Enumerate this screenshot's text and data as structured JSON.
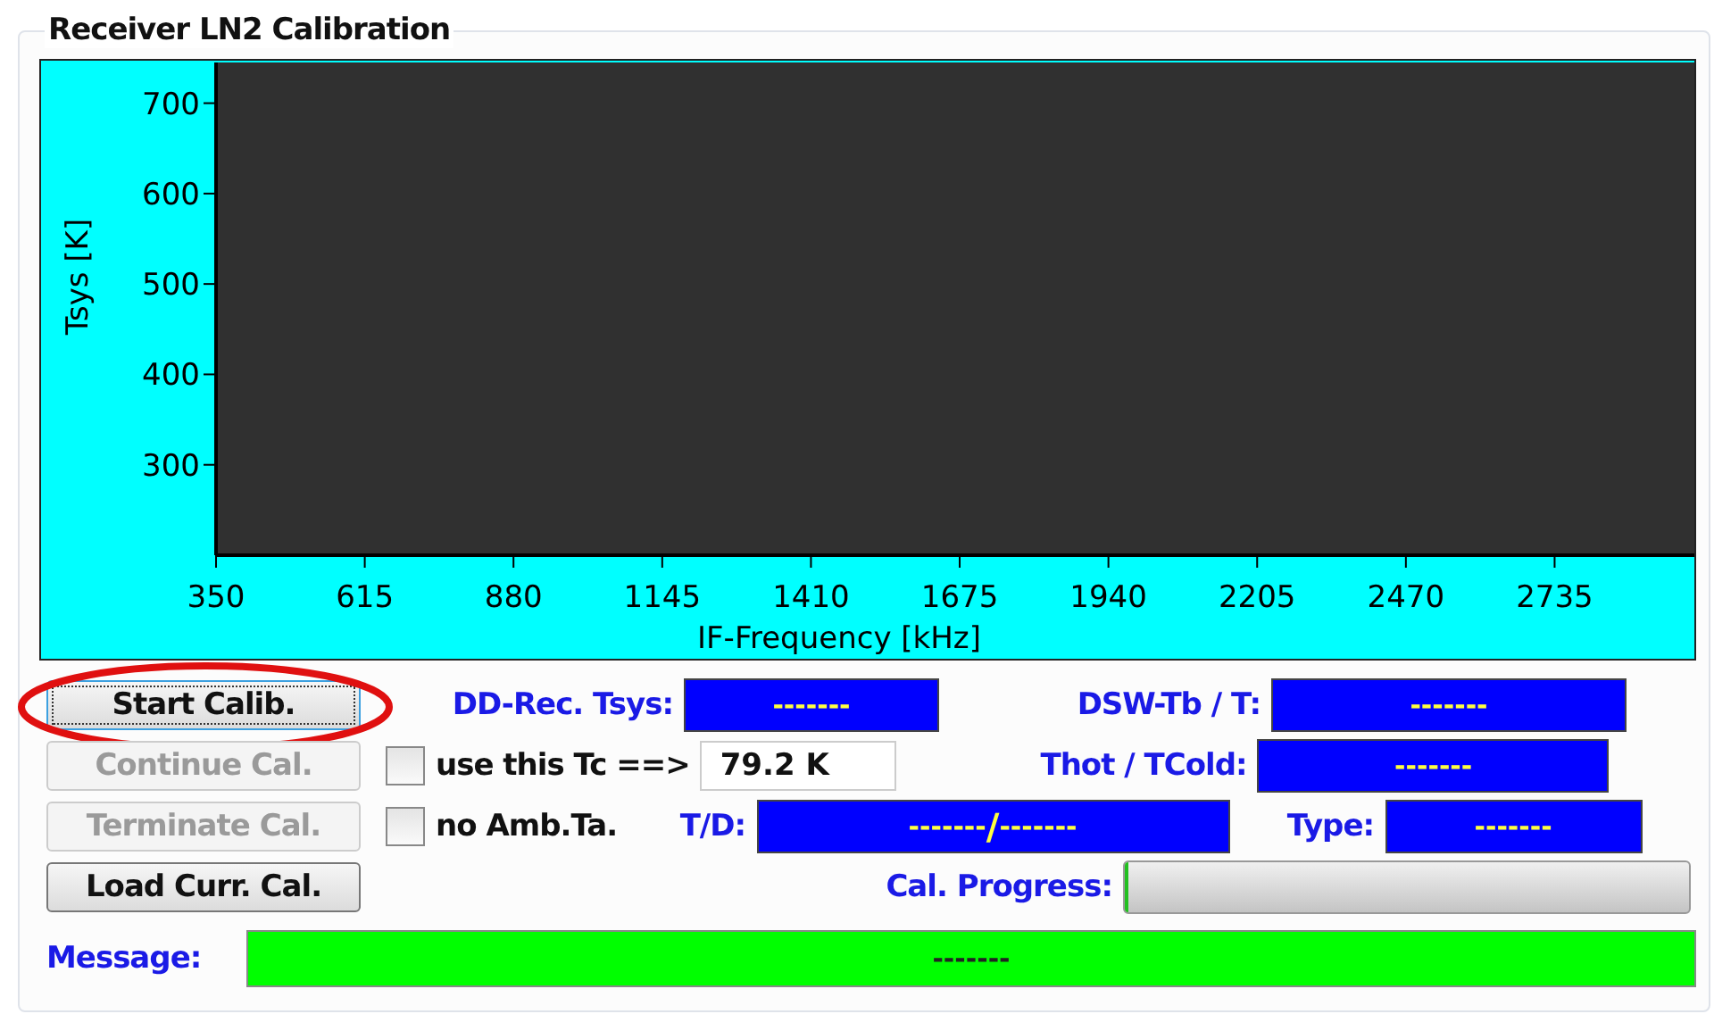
{
  "group_title": "Receiver LN2 Calibration",
  "chart": {
    "chart_data": {
      "type": "line",
      "xlabel": "IF-Frequency [kHz]",
      "ylabel": "Tsys [K]",
      "xlim": [
        350,
        2984
      ],
      "ylim": [
        200,
        745
      ],
      "xticks": [
        350,
        615,
        880,
        1145,
        1410,
        1675,
        1940,
        2205,
        2470,
        2735
      ],
      "yticks": [
        300,
        400,
        500,
        600,
        700
      ]
    }
  },
  "buttons": [
    {
      "label": "Start Calib.",
      "disabled": false,
      "focused": true,
      "highlighted": true
    },
    {
      "label": "Continue Cal.",
      "disabled": true,
      "focused": false,
      "highlighted": false
    },
    {
      "label": "Terminate Cal.",
      "disabled": true,
      "focused": false,
      "highlighted": false
    },
    {
      "label": "Load Curr. Cal.",
      "disabled": false,
      "focused": false,
      "highlighted": false
    }
  ],
  "dd_rec_tsys": {
    "label": "DD-Rec. Tsys:",
    "value": "-------"
  },
  "dsw_tb": {
    "label": "DSW-Tb / T:",
    "value": "-------"
  },
  "use_tc": {
    "label": "use this Tc ==>",
    "checked": false,
    "value": "79.2 K"
  },
  "thot_tcold": {
    "label": "Thot / TCold:",
    "value": "-------"
  },
  "no_amb": {
    "label": "no Amb.Ta.",
    "checked": false
  },
  "td": {
    "label": "T/D:",
    "value_1": "-------",
    "separator": "/",
    "value_2": "-------"
  },
  "type": {
    "label": "Type:",
    "value": "-------"
  },
  "progress": {
    "label": "Cal. Progress:",
    "level": 0
  },
  "message": {
    "label": "Message:",
    "value": "-------"
  }
}
